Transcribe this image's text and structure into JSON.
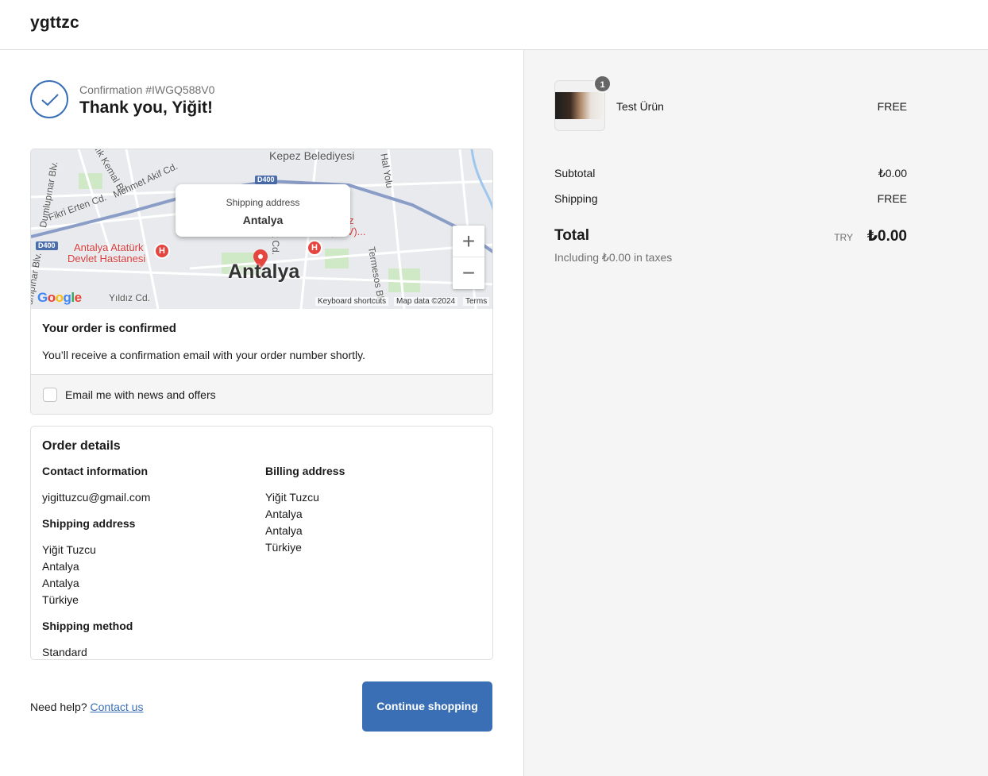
{
  "header": {
    "brand": "ygttzc"
  },
  "confirmation": {
    "number_label": "Confirmation #IWGQ588V0",
    "title": "Thank you, Yiğit!"
  },
  "map": {
    "popup_label": "Shipping address",
    "popup_value": "Antalya",
    "city_label": "Antalya",
    "places": {
      "kepez": "Kepez Belediyesi",
      "hospital_1": "Antalya Atatürk",
      "hospital_2": "Devlet Hastanesi",
      "hospital_marker": "H",
      "asv": "(ASV)...",
      "asv_prefix": "z",
      "street_1": "Namık Kemal Bl.",
      "street_2": "Mehmet Akif Cd.",
      "street_3": "Fikri Erten Cd.",
      "street_4": "Yıldız Cd.",
      "street_5": "Termesos Bl.",
      "street_6": "Hal Yolu",
      "street_7": "umpınar Blv.",
      "street_8": "k Cd.",
      "street_9": "Dumlupınar Blv.",
      "road_d400_a": "D400",
      "road_d400_b": "D400"
    },
    "zoom_in": "+",
    "zoom_out": "−",
    "google_letters": [
      "G",
      "o",
      "o",
      "g",
      "l",
      "e"
    ],
    "keyboard_shortcuts": "Keyboard shortcuts",
    "map_data": "Map data ©2024",
    "terms": "Terms"
  },
  "status_card": {
    "title": "Your order is confirmed",
    "text": "You’ll receive a confirmation email with your order number shortly.",
    "newsletter_label": "Email me with news and offers"
  },
  "order_details": {
    "title": "Order details",
    "contact": {
      "heading": "Contact information",
      "email": "yigittuzcu@gmail.com"
    },
    "shipping_address": {
      "heading": "Shipping address",
      "lines": [
        "Yiğit Tuzcu",
        "Antalya",
        "Antalya",
        "Türkiye"
      ]
    },
    "shipping_method": {
      "heading": "Shipping method",
      "value": "Standard"
    },
    "billing_address": {
      "heading": "Billing address",
      "lines": [
        "Yiğit Tuzcu",
        "Antalya",
        "Antalya",
        "Türkiye"
      ]
    }
  },
  "footer": {
    "help_text": "Need help?",
    "contact_link": "Contact us",
    "continue_button": "Continue shopping"
  },
  "summary": {
    "product": {
      "name": "Test Ürün",
      "price": "FREE",
      "quantity": "1"
    },
    "subtotal_label": "Subtotal",
    "subtotal_value": "₺0.00",
    "shipping_label": "Shipping",
    "shipping_value": "FREE",
    "total_label": "Total",
    "currency": "TRY",
    "total_value": "₺0.00",
    "tax_note": "Including ₺0.00 in taxes"
  },
  "colors": {
    "accent": "#3a6fb5",
    "sidebar_bg": "#f5f5f5",
    "border": "#dedede"
  }
}
